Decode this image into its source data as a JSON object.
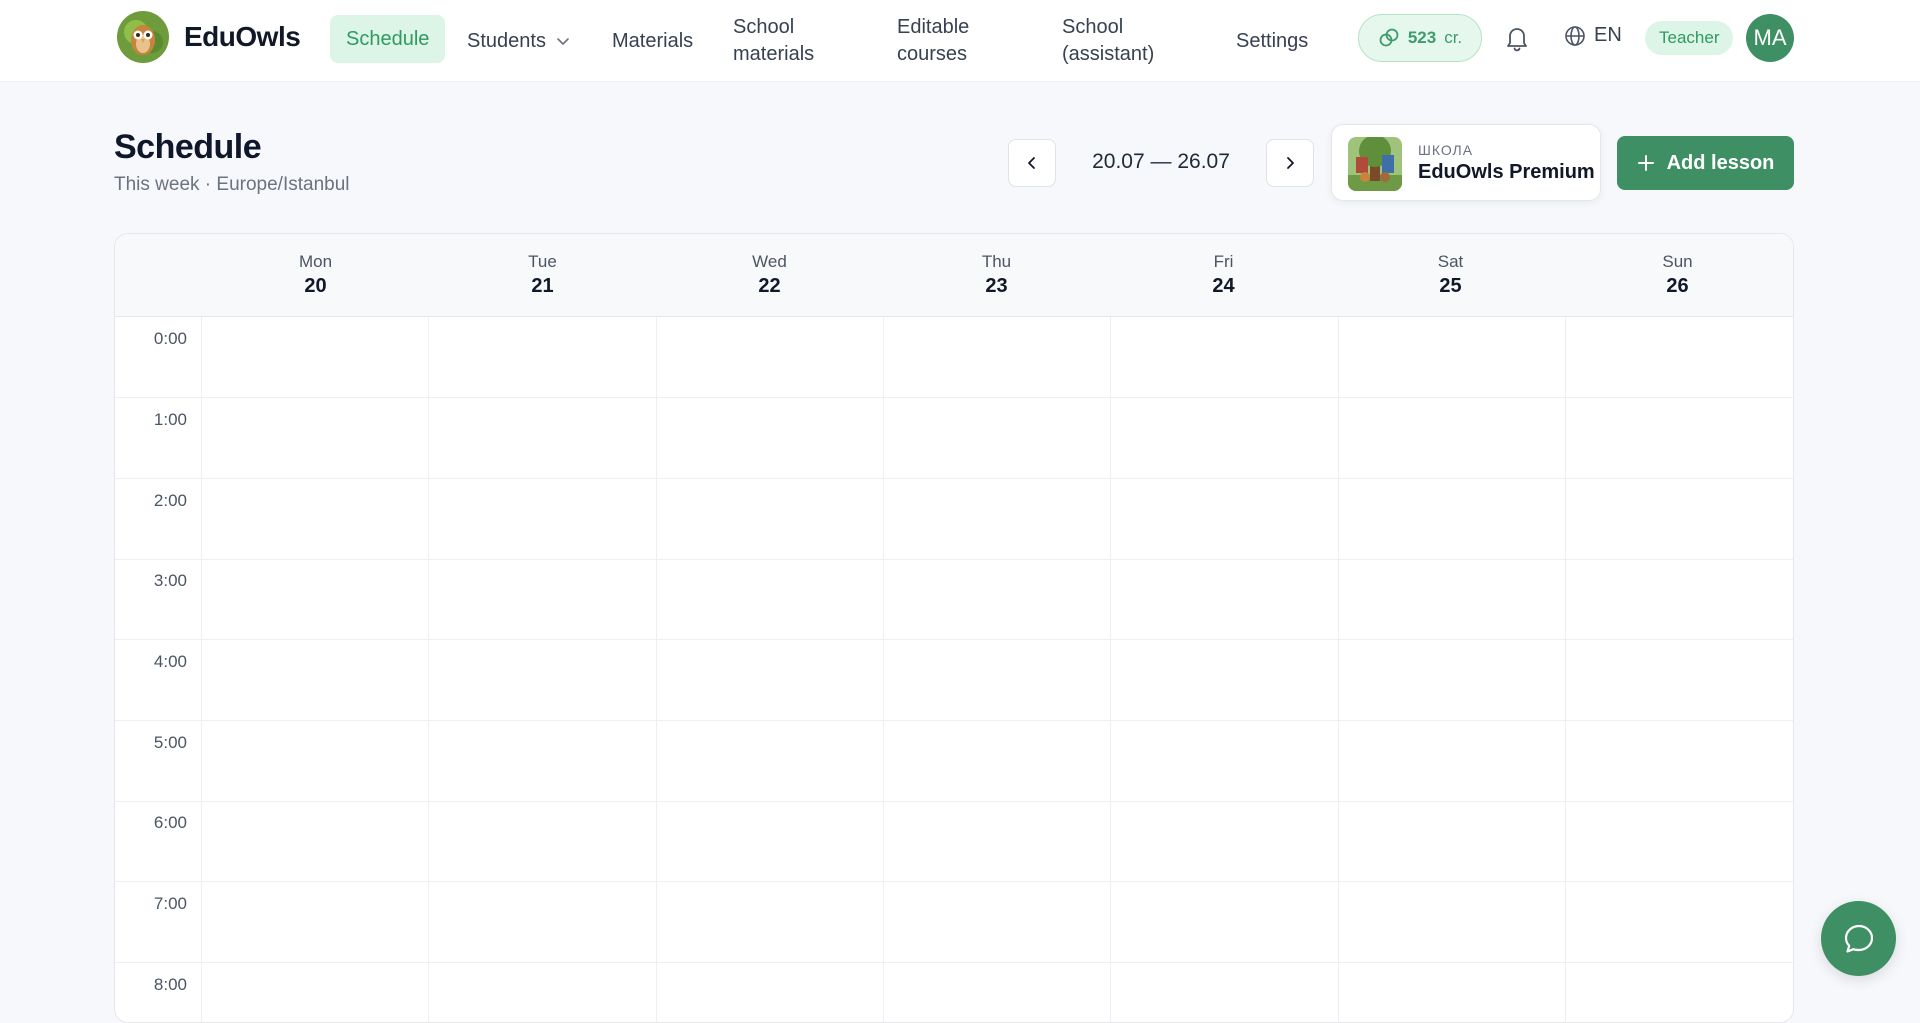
{
  "app": {
    "brand": "EduOwls"
  },
  "nav": {
    "items": [
      {
        "label": "Schedule",
        "active": true
      },
      {
        "label": "Students",
        "has_dropdown": true
      },
      {
        "label": "Materials"
      },
      {
        "label": "School materials"
      },
      {
        "label": "Editable courses"
      },
      {
        "label": "School (assistant)"
      },
      {
        "label": "Settings"
      }
    ]
  },
  "credits": {
    "amount": "523",
    "unit": "cr."
  },
  "language": "EN",
  "role": "Teacher",
  "user": {
    "initials": "MA"
  },
  "page": {
    "title": "Schedule",
    "subtitle": "This week · Europe/Istanbul"
  },
  "week": {
    "range": "20.07 — 26.07"
  },
  "school": {
    "label": "ШКОЛА",
    "name": "EduOwls Premium"
  },
  "actions": {
    "add_lesson": "Add lesson"
  },
  "calendar": {
    "days": [
      {
        "name": "Mon",
        "num": "20"
      },
      {
        "name": "Tue",
        "num": "21"
      },
      {
        "name": "Wed",
        "num": "22"
      },
      {
        "name": "Thu",
        "num": "23"
      },
      {
        "name": "Fri",
        "num": "24"
      },
      {
        "name": "Sat",
        "num": "25"
      },
      {
        "name": "Sun",
        "num": "26"
      }
    ],
    "hours": [
      "0:00",
      "1:00",
      "2:00",
      "3:00",
      "4:00",
      "5:00",
      "6:00",
      "7:00",
      "8:00"
    ]
  },
  "colors": {
    "accent": "#3e8f63",
    "accent_light": "#dcf5e6",
    "accent_text": "#2f9a62"
  },
  "icons": [
    "owl-logo-icon",
    "chevron-down-icon",
    "coins-icon",
    "bell-icon",
    "globe-icon",
    "chevron-left-icon",
    "chevron-right-icon",
    "plus-icon",
    "chat-bubble-icon"
  ]
}
